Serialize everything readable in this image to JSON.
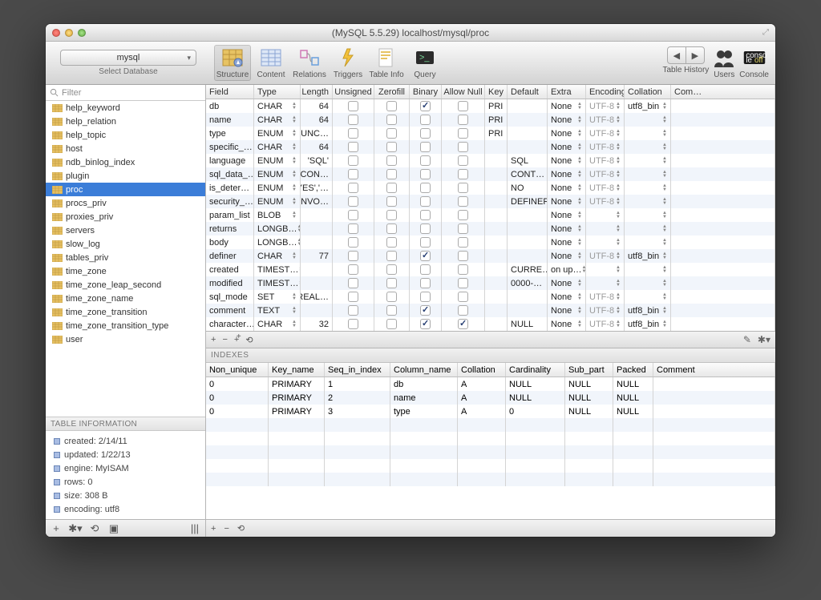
{
  "title": "(MySQL 5.5.29) localhost/mysql/proc",
  "database_selector": {
    "value": "mysql",
    "label": "Select Database"
  },
  "filter_placeholder": "Filter",
  "toolbar_tabs": [
    "Structure",
    "Content",
    "Relations",
    "Triggers",
    "Table Info",
    "Query"
  ],
  "right_tools": {
    "history": "Table History",
    "users": "Users",
    "console": "Console"
  },
  "sidebar": {
    "items": [
      "help_keyword",
      "help_relation",
      "help_topic",
      "host",
      "ndb_binlog_index",
      "plugin",
      "proc",
      "procs_priv",
      "proxies_priv",
      "servers",
      "slow_log",
      "tables_priv",
      "time_zone",
      "time_zone_leap_second",
      "time_zone_name",
      "time_zone_transition",
      "time_zone_transition_type",
      "user"
    ],
    "selected_index": 6
  },
  "table_info": {
    "header": "TABLE INFORMATION",
    "rows": [
      "created: 2/14/11",
      "updated: 1/22/13",
      "engine: MyISAM",
      "rows: 0",
      "size: 308 B",
      "encoding: utf8"
    ]
  },
  "columns_headers": [
    "Field",
    "Type",
    "Length",
    "Unsigned",
    "Zerofill",
    "Binary",
    "Allow Null",
    "Key",
    "Default",
    "Extra",
    "Encoding",
    "Collation",
    "Com…"
  ],
  "columns": [
    {
      "field": "db",
      "type": "CHAR",
      "len": "64",
      "uns": false,
      "zero": false,
      "bin": true,
      "anull": false,
      "key": "PRI",
      "def": "",
      "extra": "None",
      "enc": "UTF-8",
      "coll": "utf8_bin"
    },
    {
      "field": "name",
      "type": "CHAR",
      "len": "64",
      "uns": false,
      "zero": false,
      "bin": false,
      "anull": false,
      "key": "PRI",
      "def": "",
      "extra": "None",
      "enc": "UTF-8",
      "coll": ""
    },
    {
      "field": "type",
      "type": "ENUM",
      "len": "'FUNC…",
      "uns": false,
      "zero": false,
      "bin": false,
      "anull": false,
      "key": "PRI",
      "def": "",
      "extra": "None",
      "enc": "UTF-8",
      "coll": ""
    },
    {
      "field": "specific_…",
      "type": "CHAR",
      "len": "64",
      "uns": false,
      "zero": false,
      "bin": false,
      "anull": false,
      "key": "",
      "def": "",
      "extra": "None",
      "enc": "UTF-8",
      "coll": ""
    },
    {
      "field": "language",
      "type": "ENUM",
      "len": "'SQL'",
      "uns": false,
      "zero": false,
      "bin": false,
      "anull": false,
      "key": "",
      "def": "SQL",
      "extra": "None",
      "enc": "UTF-8",
      "coll": ""
    },
    {
      "field": "sql_data_…",
      "type": "ENUM",
      "len": "'CON…",
      "uns": false,
      "zero": false,
      "bin": false,
      "anull": false,
      "key": "",
      "def": "CONT…",
      "extra": "None",
      "enc": "UTF-8",
      "coll": ""
    },
    {
      "field": "is_deter…",
      "type": "ENUM",
      "len": "'YES','…",
      "uns": false,
      "zero": false,
      "bin": false,
      "anull": false,
      "key": "",
      "def": "NO",
      "extra": "None",
      "enc": "UTF-8",
      "coll": ""
    },
    {
      "field": "security_…",
      "type": "ENUM",
      "len": "'INVO…",
      "uns": false,
      "zero": false,
      "bin": false,
      "anull": false,
      "key": "",
      "def": "DEFINER",
      "extra": "None",
      "enc": "UTF-8",
      "coll": ""
    },
    {
      "field": "param_list",
      "type": "BLOB",
      "len": "",
      "uns": false,
      "zero": false,
      "bin": false,
      "anull": false,
      "key": "",
      "def": "",
      "extra": "None",
      "enc": "",
      "coll": ""
    },
    {
      "field": "returns",
      "type": "LONGB…",
      "len": "",
      "uns": false,
      "zero": false,
      "bin": false,
      "anull": false,
      "key": "",
      "def": "",
      "extra": "None",
      "enc": "",
      "coll": ""
    },
    {
      "field": "body",
      "type": "LONGB…",
      "len": "",
      "uns": false,
      "zero": false,
      "bin": false,
      "anull": false,
      "key": "",
      "def": "",
      "extra": "None",
      "enc": "",
      "coll": ""
    },
    {
      "field": "definer",
      "type": "CHAR",
      "len": "77",
      "uns": false,
      "zero": false,
      "bin": true,
      "anull": false,
      "key": "",
      "def": "",
      "extra": "None",
      "enc": "UTF-8",
      "coll": "utf8_bin"
    },
    {
      "field": "created",
      "type": "TIMEST…",
      "len": "",
      "uns": false,
      "zero": false,
      "bin": false,
      "anull": false,
      "key": "",
      "def": "CURRE…",
      "extra": "on up…",
      "enc": "",
      "coll": ""
    },
    {
      "field": "modified",
      "type": "TIMEST…",
      "len": "",
      "uns": false,
      "zero": false,
      "bin": false,
      "anull": false,
      "key": "",
      "def": "0000-…",
      "extra": "None",
      "enc": "",
      "coll": ""
    },
    {
      "field": "sql_mode",
      "type": "SET",
      "len": "'REAL…",
      "uns": false,
      "zero": false,
      "bin": false,
      "anull": false,
      "key": "",
      "def": "",
      "extra": "None",
      "enc": "UTF-8",
      "coll": ""
    },
    {
      "field": "comment",
      "type": "TEXT",
      "len": "",
      "uns": false,
      "zero": false,
      "bin": true,
      "anull": false,
      "key": "",
      "def": "",
      "extra": "None",
      "enc": "UTF-8",
      "coll": "utf8_bin"
    },
    {
      "field": "character…",
      "type": "CHAR",
      "len": "32",
      "uns": false,
      "zero": false,
      "bin": true,
      "anull": true,
      "key": "",
      "def": "NULL",
      "extra": "None",
      "enc": "UTF-8",
      "coll": "utf8_bin"
    }
  ],
  "indexes_header": "INDEXES",
  "index_cols": [
    "Non_unique",
    "Key_name",
    "Seq_in_index",
    "Column_name",
    "Collation",
    "Cardinality",
    "Sub_part",
    "Packed",
    "Comment"
  ],
  "indexes": [
    {
      "nu": "0",
      "kn": "PRIMARY",
      "si": "1",
      "cn": "db",
      "co": "A",
      "ca": "NULL",
      "sp": "NULL",
      "pk": "NULL",
      "cm": ""
    },
    {
      "nu": "0",
      "kn": "PRIMARY",
      "si": "2",
      "cn": "name",
      "co": "A",
      "ca": "NULL",
      "sp": "NULL",
      "pk": "NULL",
      "cm": ""
    },
    {
      "nu": "0",
      "kn": "PRIMARY",
      "si": "3",
      "cn": "type",
      "co": "A",
      "ca": "0",
      "sp": "NULL",
      "pk": "NULL",
      "cm": ""
    }
  ]
}
